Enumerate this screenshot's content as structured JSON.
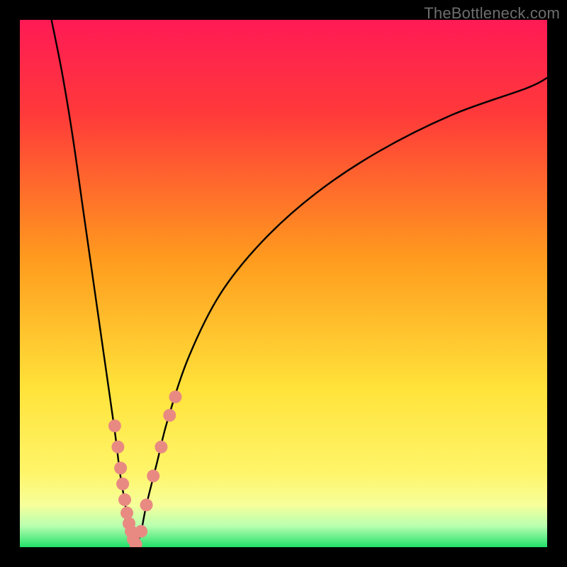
{
  "watermark": "TheBottleneck.com",
  "chart_data": {
    "type": "line",
    "title": "",
    "xlabel": "",
    "ylabel": "",
    "xlim": [
      0,
      100
    ],
    "ylim": [
      0,
      100
    ],
    "grid": false,
    "legend": false,
    "background_gradient_stops": [
      {
        "pct": 0,
        "color": "#ff1a55"
      },
      {
        "pct": 18,
        "color": "#ff3a3a"
      },
      {
        "pct": 45,
        "color": "#ff9a1e"
      },
      {
        "pct": 70,
        "color": "#ffe33a"
      },
      {
        "pct": 86,
        "color": "#fff56a"
      },
      {
        "pct": 92,
        "color": "#f6ff9a"
      },
      {
        "pct": 96,
        "color": "#b8ffb0"
      },
      {
        "pct": 100,
        "color": "#22e06a"
      }
    ],
    "series": [
      {
        "name": "left-branch",
        "color": "#000000",
        "x": [
          6,
          8,
          10,
          12,
          14,
          16,
          18,
          19,
          20,
          20.5,
          21,
          21.3,
          21.6
        ],
        "y": [
          100,
          90,
          78,
          64,
          50,
          36,
          22,
          14,
          8,
          4,
          2,
          1,
          0
        ]
      },
      {
        "name": "right-branch",
        "color": "#000000",
        "x": [
          22,
          23,
          24,
          26,
          28,
          32,
          38,
          46,
          56,
          68,
          82,
          96,
          100
        ],
        "y": [
          0,
          3,
          8,
          16,
          24,
          36,
          48,
          58,
          67,
          75,
          82,
          87,
          89
        ]
      }
    ],
    "marker_series": [
      {
        "name": "left-markers",
        "color": "#e88a82",
        "radius": 9,
        "x": [
          18.0,
          18.6,
          19.1,
          19.5,
          19.9,
          20.3,
          20.7,
          21.1,
          21.5,
          22.0
        ],
        "y": [
          23.0,
          19.0,
          15.0,
          12.0,
          9.0,
          6.5,
          4.5,
          3.0,
          1.5,
          0.5
        ]
      },
      {
        "name": "right-markers",
        "color": "#e88a82",
        "radius": 9,
        "x": [
          23.0,
          24.0,
          25.3,
          26.8,
          28.4,
          29.5
        ],
        "y": [
          3.0,
          8.0,
          13.5,
          19.0,
          25.0,
          28.5
        ]
      }
    ]
  }
}
